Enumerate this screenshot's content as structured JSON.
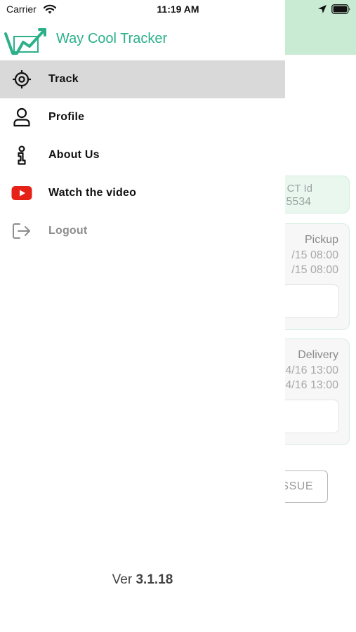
{
  "status_bar": {
    "carrier": "Carrier",
    "time": "11:19 AM"
  },
  "drawer": {
    "app_title": "Way Cool Tracker",
    "menu": [
      {
        "label": "Track",
        "icon": "crosshair-icon",
        "active": true
      },
      {
        "label": "Profile",
        "icon": "user-icon",
        "active": false
      },
      {
        "label": "About Us",
        "icon": "info-icon",
        "active": false
      },
      {
        "label": "Watch the video",
        "icon": "youtube-icon",
        "active": false
      },
      {
        "label": "Logout",
        "icon": "logout-icon",
        "active": false
      }
    ],
    "version_prefix": "Ver",
    "version_number": "3.1.18"
  },
  "background": {
    "id_label": "CT Id",
    "id_value": "5534",
    "pickup": {
      "title": "Pickup",
      "line1": "/15 08:00",
      "line2": "/15 08:00"
    },
    "delivery": {
      "title": "Delivery",
      "line1": "4/16 13:00",
      "line2": "4/16 13:00"
    },
    "issue_button": "SSUE"
  },
  "colors": {
    "brand": "#2bb089",
    "header_bg": "#c9ebd4",
    "active_bg": "#d9d9d9",
    "youtube_red": "#e62117"
  }
}
